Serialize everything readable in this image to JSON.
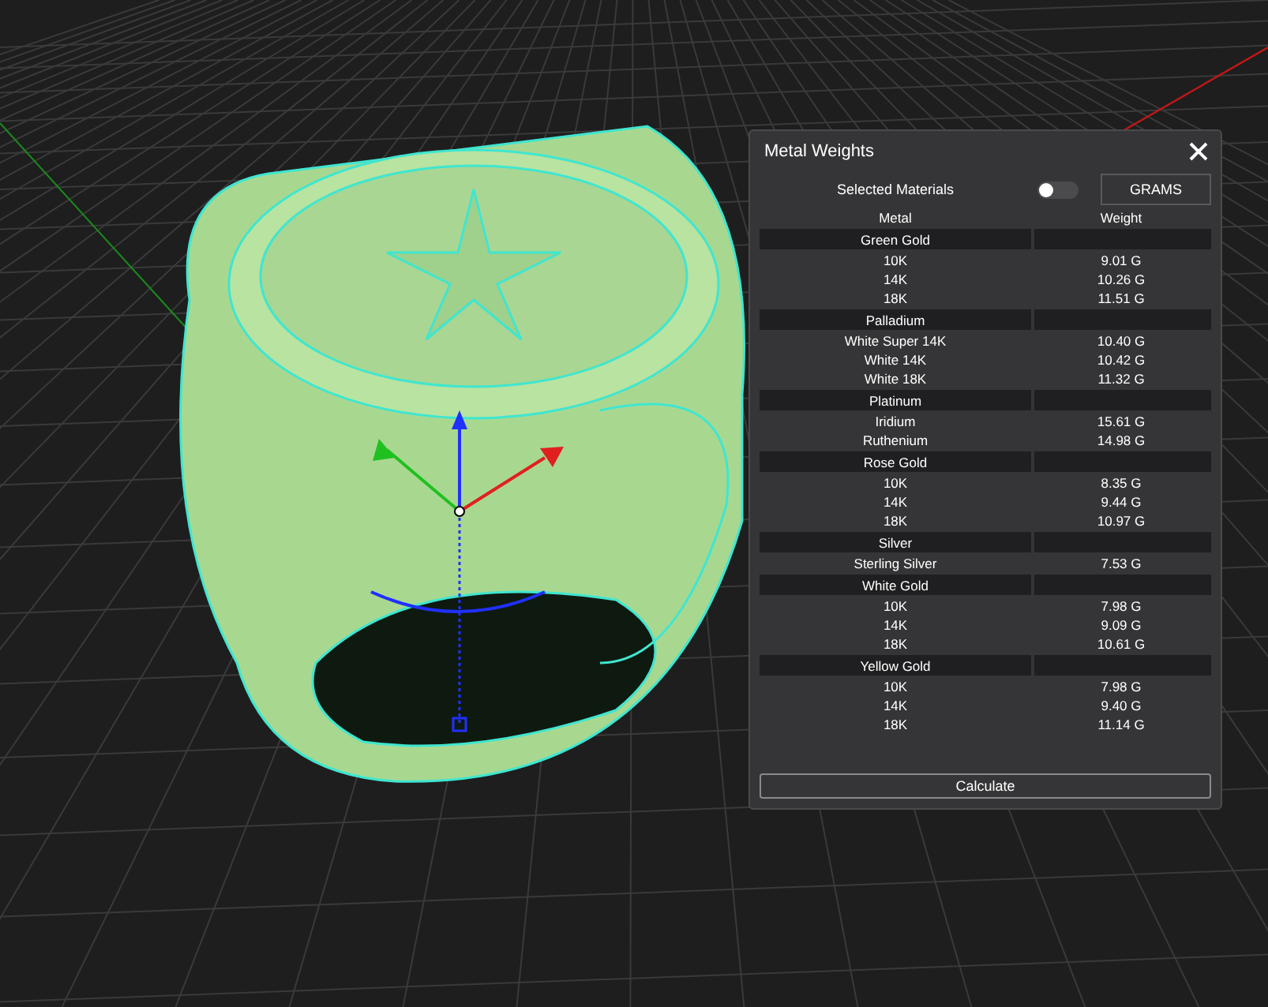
{
  "panel": {
    "title": "Metal Weights",
    "selected_materials": {
      "label": "Selected Materials",
      "on": false
    },
    "unit_button": "GRAMS",
    "columns": [
      "Metal",
      "Weight"
    ],
    "groups": [
      {
        "name": "Green Gold",
        "rows": [
          {
            "metal": "10K",
            "weight": "9.01 G"
          },
          {
            "metal": "14K",
            "weight": "10.26 G"
          },
          {
            "metal": "18K",
            "weight": "11.51 G"
          }
        ]
      },
      {
        "name": "Palladium",
        "rows": [
          {
            "metal": "White Super 14K",
            "weight": "10.40 G"
          },
          {
            "metal": "White 14K",
            "weight": "10.42 G"
          },
          {
            "metal": "White 18K",
            "weight": "11.32 G"
          }
        ]
      },
      {
        "name": "Platinum",
        "rows": [
          {
            "metal": "Iridium",
            "weight": "15.61 G"
          },
          {
            "metal": "Ruthenium",
            "weight": "14.98 G"
          }
        ]
      },
      {
        "name": "Rose Gold",
        "rows": [
          {
            "metal": "10K",
            "weight": "8.35 G"
          },
          {
            "metal": "14K",
            "weight": "9.44 G"
          },
          {
            "metal": "18K",
            "weight": "10.97 G"
          }
        ]
      },
      {
        "name": "Silver",
        "rows": [
          {
            "metal": "Sterling Silver",
            "weight": "7.53 G"
          }
        ]
      },
      {
        "name": "White Gold",
        "rows": [
          {
            "metal": "10K",
            "weight": "7.98 G"
          },
          {
            "metal": "14K",
            "weight": "9.09 G"
          },
          {
            "metal": "18K",
            "weight": "10.61 G"
          }
        ]
      },
      {
        "name": "Yellow Gold",
        "rows": [
          {
            "metal": "10K",
            "weight": "7.98 G"
          },
          {
            "metal": "14K",
            "weight": "9.40 G"
          },
          {
            "metal": "18K",
            "weight": "11.14 G"
          }
        ]
      }
    ],
    "action_button": "Calculate"
  }
}
